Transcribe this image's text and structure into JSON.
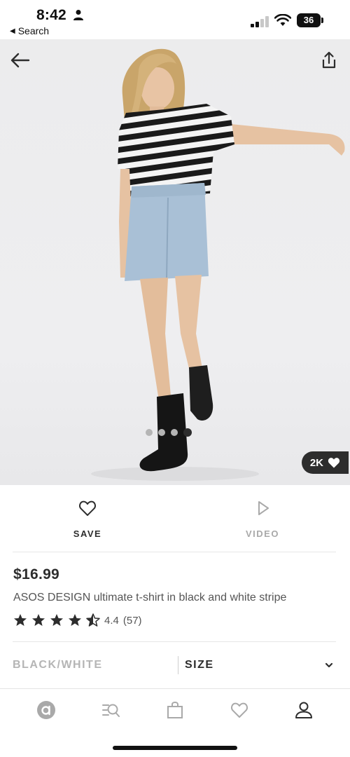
{
  "status_bar": {
    "time": "8:42",
    "back_label": "Search",
    "battery": "36"
  },
  "hero": {
    "likes_badge": "2K",
    "carousel_total": 4,
    "carousel_active": 4
  },
  "actions": {
    "save_label": "SAVE",
    "video_label": "VIDEO"
  },
  "product": {
    "price": "$16.99",
    "title": "ASOS DESIGN ultimate t-shirt in black and white stripe",
    "rating_value": 4.4,
    "rating_text": "4.4",
    "review_count": "(57)"
  },
  "selectors": {
    "color": "BLACK/WHITE",
    "size": "SIZE"
  },
  "bottom_nav": {
    "items": [
      "home-icon",
      "search-icon",
      "bag-icon",
      "saved-icon",
      "account-icon"
    ]
  },
  "colors": {
    "text_primary": "#2d2d2d",
    "text_muted": "#a9a9a9",
    "badge_bg": "#2d2d2d"
  }
}
